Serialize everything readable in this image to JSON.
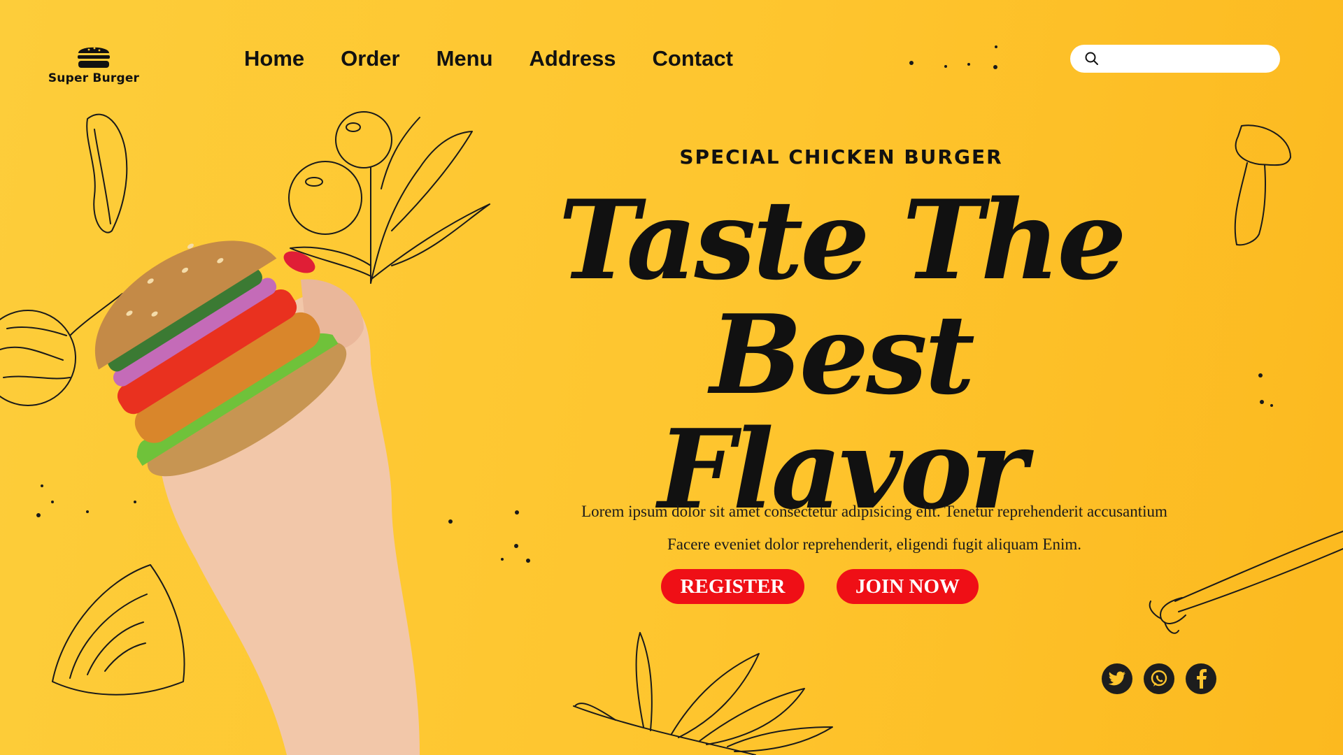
{
  "brand": {
    "name": "Super Burger",
    "icon": "burger-icon"
  },
  "nav": [
    {
      "label": "Home"
    },
    {
      "label": "Order"
    },
    {
      "label": "Menu"
    },
    {
      "label": "Address"
    },
    {
      "label": "Contact"
    }
  ],
  "search": {
    "placeholder": "",
    "value": "",
    "icon": "search-icon"
  },
  "hero": {
    "subtitle": "SPECIAL CHICKEN BURGER",
    "headline_line1": "Taste The",
    "headline_line2": "Best Flavor",
    "description_line1": "Lorem ipsum dolor sit amet consectetur adipisicing elit. Tenetur reprehenderit accusantium",
    "description_line2": "Facere eveniet dolor reprehenderit, eligendi fugit aliquam Enim.",
    "register_label": "REGISTER",
    "join_label": "JOIN NOW"
  },
  "social": [
    {
      "icon": "twitter-icon"
    },
    {
      "icon": "whatsapp-icon"
    },
    {
      "icon": "facebook-icon"
    }
  ],
  "colors": {
    "background": "#fec52e",
    "accent": "#ef0f16",
    "text": "#111111"
  }
}
